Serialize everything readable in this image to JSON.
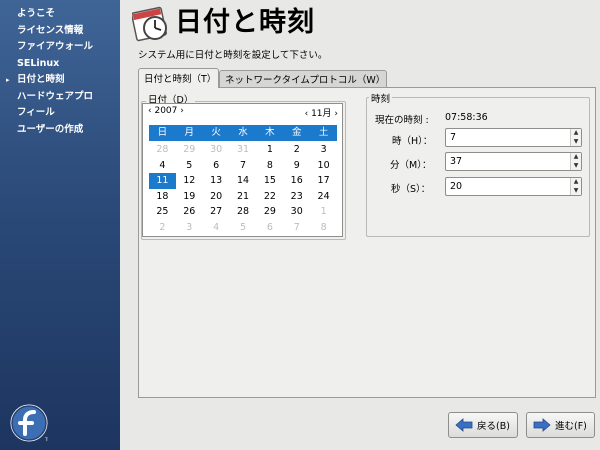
{
  "sidebar": {
    "items": [
      {
        "label": "ようこそ",
        "current": false
      },
      {
        "label": "ライセンス情報",
        "current": false
      },
      {
        "label": "ファイアウォール",
        "current": false
      },
      {
        "label": "SELinux",
        "current": false
      },
      {
        "label": "日付と時刻",
        "current": true
      },
      {
        "label": "ハードウェアプロ",
        "current": false
      },
      {
        "label": "フィール",
        "current": false
      },
      {
        "label": "ユーザーの作成",
        "current": false
      }
    ],
    "current_marker": "▸",
    "logo_icon": "fedora-logo-icon",
    "logo_mark": "TM"
  },
  "header": {
    "title": "日付と時刻",
    "description": "システム用に日付と時刻を設定して下さい。",
    "icon": "clock-calendar-icon"
  },
  "tabs": [
    {
      "label": "日付と時刻（T）",
      "active": true
    },
    {
      "label": "ネットワークタイムプロトコル（W）",
      "active": false
    }
  ],
  "date_group": {
    "label": "日付（D）",
    "year": "2007",
    "month": "11月",
    "prev": "‹",
    "next": "›",
    "weekdays": [
      "日",
      "月",
      "火",
      "水",
      "木",
      "金",
      "土"
    ],
    "weeks": [
      [
        {
          "d": "28",
          "dim": true
        },
        {
          "d": "29",
          "dim": true
        },
        {
          "d": "30",
          "dim": true
        },
        {
          "d": "31",
          "dim": true
        },
        {
          "d": "1"
        },
        {
          "d": "2"
        },
        {
          "d": "3"
        }
      ],
      [
        {
          "d": "4"
        },
        {
          "d": "5"
        },
        {
          "d": "6"
        },
        {
          "d": "7"
        },
        {
          "d": "8"
        },
        {
          "d": "9"
        },
        {
          "d": "10"
        }
      ],
      [
        {
          "d": "11",
          "sel": true
        },
        {
          "d": "12"
        },
        {
          "d": "13"
        },
        {
          "d": "14"
        },
        {
          "d": "15"
        },
        {
          "d": "16"
        },
        {
          "d": "17"
        }
      ],
      [
        {
          "d": "18"
        },
        {
          "d": "19"
        },
        {
          "d": "20"
        },
        {
          "d": "21"
        },
        {
          "d": "22"
        },
        {
          "d": "23"
        },
        {
          "d": "24"
        }
      ],
      [
        {
          "d": "25"
        },
        {
          "d": "26"
        },
        {
          "d": "27"
        },
        {
          "d": "28"
        },
        {
          "d": "29"
        },
        {
          "d": "30"
        },
        {
          "d": "1",
          "dim": true
        }
      ],
      [
        {
          "d": "2",
          "dim": true
        },
        {
          "d": "3",
          "dim": true
        },
        {
          "d": "4",
          "dim": true
        },
        {
          "d": "5",
          "dim": true
        },
        {
          "d": "6",
          "dim": true
        },
        {
          "d": "7",
          "dim": true
        },
        {
          "d": "8",
          "dim": true
        }
      ]
    ]
  },
  "time_group": {
    "label": "時刻",
    "current_label": "現在の時刻 :",
    "current_value": "07:58:36",
    "hour_label": "時（H）：",
    "hour_value": "7",
    "minute_label": "分（M）：",
    "minute_value": "37",
    "second_label": "秒（S）：",
    "second_value": "20"
  },
  "buttons": {
    "back": "戻る(B)",
    "next": "進む(F)"
  },
  "colors": {
    "sidebar": "#2b4a78",
    "selection": "#1b7acb"
  }
}
